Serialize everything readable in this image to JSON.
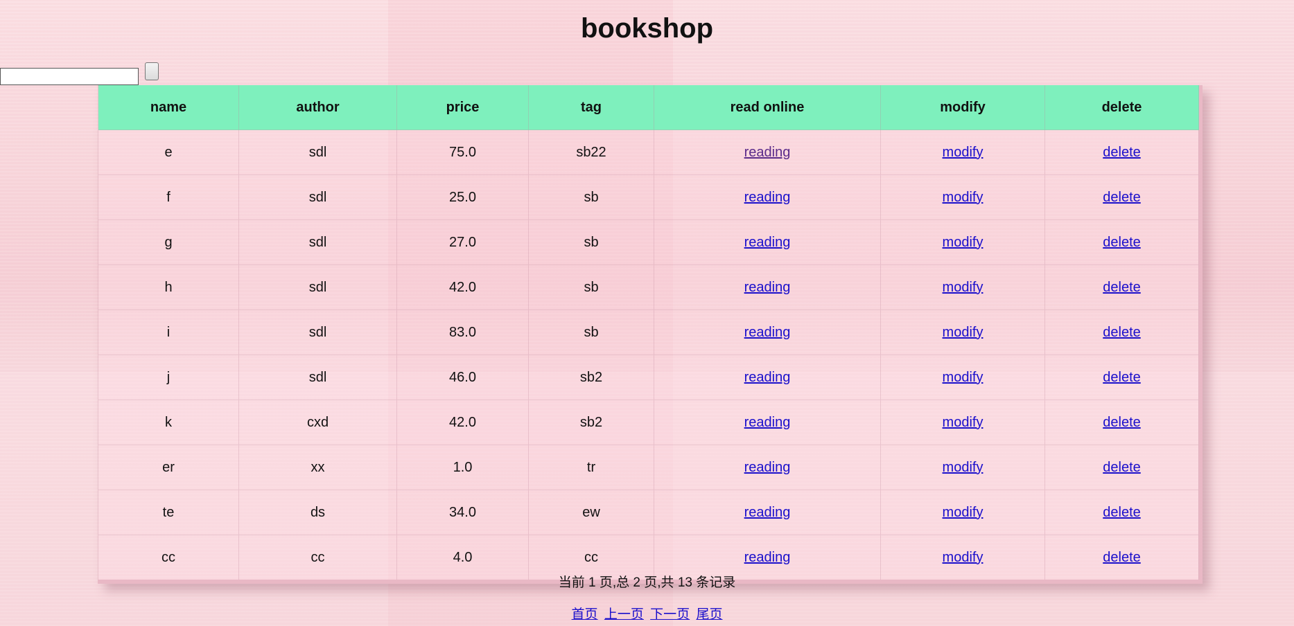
{
  "page": {
    "title": "bookshop"
  },
  "search": {
    "value": "",
    "button_label": ""
  },
  "table": {
    "headers": [
      "name",
      "author",
      "price",
      "tag",
      "read online",
      "modify",
      "delete"
    ],
    "rows": [
      {
        "name": "e",
        "author": "sdl",
        "price": "75.0",
        "tag": "sb22",
        "read": "reading",
        "modify": "modify",
        "delete": "delete"
      },
      {
        "name": "f",
        "author": "sdl",
        "price": "25.0",
        "tag": "sb",
        "read": "reading",
        "modify": "modify",
        "delete": "delete"
      },
      {
        "name": "g",
        "author": "sdl",
        "price": "27.0",
        "tag": "sb",
        "read": "reading",
        "modify": "modify",
        "delete": "delete"
      },
      {
        "name": "h",
        "author": "sdl",
        "price": "42.0",
        "tag": "sb",
        "read": "reading",
        "modify": "modify",
        "delete": "delete"
      },
      {
        "name": "i",
        "author": "sdl",
        "price": "83.0",
        "tag": "sb",
        "read": "reading",
        "modify": "modify",
        "delete": "delete"
      },
      {
        "name": "j",
        "author": "sdl",
        "price": "46.0",
        "tag": "sb2",
        "read": "reading",
        "modify": "modify",
        "delete": "delete"
      },
      {
        "name": "k",
        "author": "cxd",
        "price": "42.0",
        "tag": "sb2",
        "read": "reading",
        "modify": "modify",
        "delete": "delete"
      },
      {
        "name": "er",
        "author": "xx",
        "price": "1.0",
        "tag": "tr",
        "read": "reading",
        "modify": "modify",
        "delete": "delete"
      },
      {
        "name": "te",
        "author": "ds",
        "price": "34.0",
        "tag": "ew",
        "read": "reading",
        "modify": "modify",
        "delete": "delete"
      },
      {
        "name": "cc",
        "author": "cc",
        "price": "4.0",
        "tag": "cc",
        "read": "reading",
        "modify": "modify",
        "delete": "delete"
      }
    ]
  },
  "pagination": {
    "info": "当前 1 页,总 2 页,共 13 条记录",
    "first": "首页",
    "prev": "上一页",
    "next": "下一页",
    "last": "尾页"
  },
  "colors": {
    "header_bg": "#7ef0bd",
    "link": "#1a0fcc",
    "visited_link": "#5a2a8a",
    "page_bg": "#f6d3d8"
  }
}
